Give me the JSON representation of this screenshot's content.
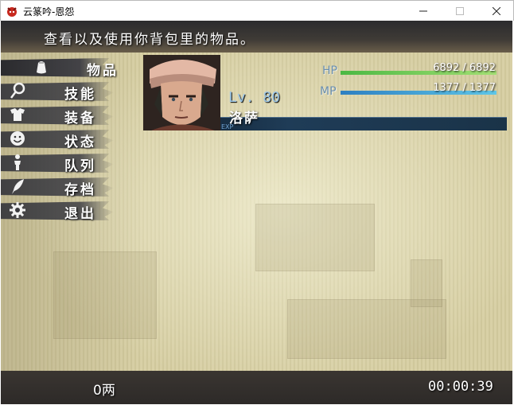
{
  "window": {
    "title": "云篆吟-恩怨"
  },
  "help_text": "查看以及使用你背包里的物品。",
  "menu": {
    "items": [
      {
        "label": "物品",
        "icon": "bag-icon",
        "selected": true
      },
      {
        "label": "技能",
        "icon": "magic-wand-icon",
        "selected": false
      },
      {
        "label": "装备",
        "icon": "armor-icon",
        "selected": false
      },
      {
        "label": "状态",
        "icon": "smiley-face-icon",
        "selected": false
      },
      {
        "label": "队列",
        "icon": "person-icon",
        "selected": false
      },
      {
        "label": "存档",
        "icon": "feather-quill-icon",
        "selected": false
      },
      {
        "label": "退出",
        "icon": "gear-icon",
        "selected": false
      }
    ]
  },
  "actor": {
    "name": "洛萨",
    "level_label": "Lv. 80",
    "exp_label": "EXP",
    "hp_label": "HP",
    "hp_value": "6892 / 6892",
    "hp_ratio": 1.0,
    "mp_label": "MP",
    "mp_value": "1377 / 1377",
    "mp_ratio": 1.0
  },
  "footer": {
    "gold": "0两",
    "playtime": "00:00:39"
  },
  "colors": {
    "hp_gauge": "#4bb843",
    "mp_gauge": "#2d7fc1",
    "level_text": "#9ec8e8",
    "panel_dark": "#2d2a28"
  }
}
